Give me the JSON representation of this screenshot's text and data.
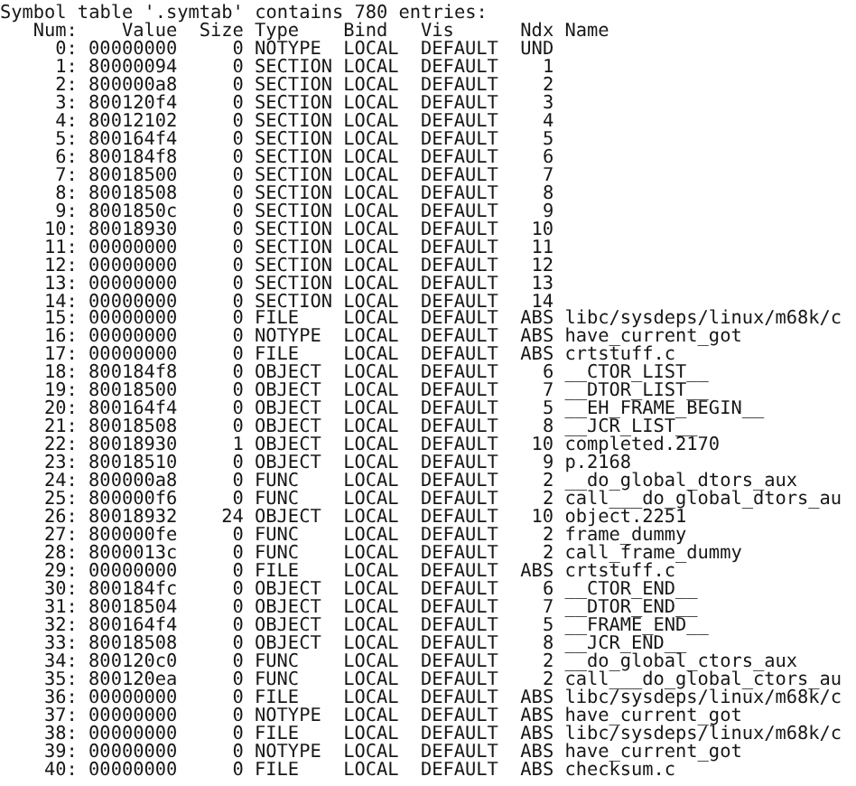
{
  "title": "Symbol table '.symtab' contains 780 entries:",
  "columns": [
    "Num:",
    "Value",
    "Size",
    "Type",
    "Bind",
    "Vis",
    "Ndx",
    "Name"
  ],
  "rows": [
    {
      "num": "0:",
      "value": "00000000",
      "size": "0",
      "type": "NOTYPE",
      "bind": "LOCAL",
      "vis": "DEFAULT",
      "ndx": "UND",
      "name": ""
    },
    {
      "num": "1:",
      "value": "80000094",
      "size": "0",
      "type": "SECTION",
      "bind": "LOCAL",
      "vis": "DEFAULT",
      "ndx": "1",
      "name": ""
    },
    {
      "num": "2:",
      "value": "800000a8",
      "size": "0",
      "type": "SECTION",
      "bind": "LOCAL",
      "vis": "DEFAULT",
      "ndx": "2",
      "name": ""
    },
    {
      "num": "3:",
      "value": "800120f4",
      "size": "0",
      "type": "SECTION",
      "bind": "LOCAL",
      "vis": "DEFAULT",
      "ndx": "3",
      "name": ""
    },
    {
      "num": "4:",
      "value": "80012102",
      "size": "0",
      "type": "SECTION",
      "bind": "LOCAL",
      "vis": "DEFAULT",
      "ndx": "4",
      "name": ""
    },
    {
      "num": "5:",
      "value": "800164f4",
      "size": "0",
      "type": "SECTION",
      "bind": "LOCAL",
      "vis": "DEFAULT",
      "ndx": "5",
      "name": ""
    },
    {
      "num": "6:",
      "value": "800184f8",
      "size": "0",
      "type": "SECTION",
      "bind": "LOCAL",
      "vis": "DEFAULT",
      "ndx": "6",
      "name": ""
    },
    {
      "num": "7:",
      "value": "80018500",
      "size": "0",
      "type": "SECTION",
      "bind": "LOCAL",
      "vis": "DEFAULT",
      "ndx": "7",
      "name": ""
    },
    {
      "num": "8:",
      "value": "80018508",
      "size": "0",
      "type": "SECTION",
      "bind": "LOCAL",
      "vis": "DEFAULT",
      "ndx": "8",
      "name": ""
    },
    {
      "num": "9:",
      "value": "8001850c",
      "size": "0",
      "type": "SECTION",
      "bind": "LOCAL",
      "vis": "DEFAULT",
      "ndx": "9",
      "name": ""
    },
    {
      "num": "10:",
      "value": "80018930",
      "size": "0",
      "type": "SECTION",
      "bind": "LOCAL",
      "vis": "DEFAULT",
      "ndx": "10",
      "name": ""
    },
    {
      "num": "11:",
      "value": "00000000",
      "size": "0",
      "type": "SECTION",
      "bind": "LOCAL",
      "vis": "DEFAULT",
      "ndx": "11",
      "name": ""
    },
    {
      "num": "12:",
      "value": "00000000",
      "size": "0",
      "type": "SECTION",
      "bind": "LOCAL",
      "vis": "DEFAULT",
      "ndx": "12",
      "name": ""
    },
    {
      "num": "13:",
      "value": "00000000",
      "size": "0",
      "type": "SECTION",
      "bind": "LOCAL",
      "vis": "DEFAULT",
      "ndx": "13",
      "name": ""
    },
    {
      "num": "14:",
      "value": "00000000",
      "size": "0",
      "type": "SECTION",
      "bind": "LOCAL",
      "vis": "DEFAULT",
      "ndx": "14",
      "name": ""
    },
    {
      "num": "15:",
      "value": "00000000",
      "size": "0",
      "type": "FILE",
      "bind": "LOCAL",
      "vis": "DEFAULT",
      "ndx": "ABS",
      "name": "libc/sysdeps/linux/m68k/c"
    },
    {
      "num": "16:",
      "value": "00000000",
      "size": "0",
      "type": "NOTYPE",
      "bind": "LOCAL",
      "vis": "DEFAULT",
      "ndx": "ABS",
      "name": "have_current_got"
    },
    {
      "num": "17:",
      "value": "00000000",
      "size": "0",
      "type": "FILE",
      "bind": "LOCAL",
      "vis": "DEFAULT",
      "ndx": "ABS",
      "name": "crtstuff.c"
    },
    {
      "num": "18:",
      "value": "800184f8",
      "size": "0",
      "type": "OBJECT",
      "bind": "LOCAL",
      "vis": "DEFAULT",
      "ndx": "6",
      "name": "__CTOR_LIST__"
    },
    {
      "num": "19:",
      "value": "80018500",
      "size": "0",
      "type": "OBJECT",
      "bind": "LOCAL",
      "vis": "DEFAULT",
      "ndx": "7",
      "name": "__DTOR_LIST__"
    },
    {
      "num": "20:",
      "value": "800164f4",
      "size": "0",
      "type": "OBJECT",
      "bind": "LOCAL",
      "vis": "DEFAULT",
      "ndx": "5",
      "name": "__EH_FRAME_BEGIN__"
    },
    {
      "num": "21:",
      "value": "80018508",
      "size": "0",
      "type": "OBJECT",
      "bind": "LOCAL",
      "vis": "DEFAULT",
      "ndx": "8",
      "name": "__JCR_LIST__"
    },
    {
      "num": "22:",
      "value": "80018930",
      "size": "1",
      "type": "OBJECT",
      "bind": "LOCAL",
      "vis": "DEFAULT",
      "ndx": "10",
      "name": "completed.2170"
    },
    {
      "num": "23:",
      "value": "80018510",
      "size": "0",
      "type": "OBJECT",
      "bind": "LOCAL",
      "vis": "DEFAULT",
      "ndx": "9",
      "name": "p.2168"
    },
    {
      "num": "24:",
      "value": "800000a8",
      "size": "0",
      "type": "FUNC",
      "bind": "LOCAL",
      "vis": "DEFAULT",
      "ndx": "2",
      "name": "__do_global_dtors_aux"
    },
    {
      "num": "25:",
      "value": "800000f6",
      "size": "0",
      "type": "FUNC",
      "bind": "LOCAL",
      "vis": "DEFAULT",
      "ndx": "2",
      "name": "call___do_global_dtors_au"
    },
    {
      "num": "26:",
      "value": "80018932",
      "size": "24",
      "type": "OBJECT",
      "bind": "LOCAL",
      "vis": "DEFAULT",
      "ndx": "10",
      "name": "object.2251"
    },
    {
      "num": "27:",
      "value": "800000fe",
      "size": "0",
      "type": "FUNC",
      "bind": "LOCAL",
      "vis": "DEFAULT",
      "ndx": "2",
      "name": "frame_dummy"
    },
    {
      "num": "28:",
      "value": "8000013c",
      "size": "0",
      "type": "FUNC",
      "bind": "LOCAL",
      "vis": "DEFAULT",
      "ndx": "2",
      "name": "call_frame_dummy"
    },
    {
      "num": "29:",
      "value": "00000000",
      "size": "0",
      "type": "FILE",
      "bind": "LOCAL",
      "vis": "DEFAULT",
      "ndx": "ABS",
      "name": "crtstuff.c"
    },
    {
      "num": "30:",
      "value": "800184fc",
      "size": "0",
      "type": "OBJECT",
      "bind": "LOCAL",
      "vis": "DEFAULT",
      "ndx": "6",
      "name": "__CTOR_END__"
    },
    {
      "num": "31:",
      "value": "80018504",
      "size": "0",
      "type": "OBJECT",
      "bind": "LOCAL",
      "vis": "DEFAULT",
      "ndx": "7",
      "name": "__DTOR_END__"
    },
    {
      "num": "32:",
      "value": "800164f4",
      "size": "0",
      "type": "OBJECT",
      "bind": "LOCAL",
      "vis": "DEFAULT",
      "ndx": "5",
      "name": "__FRAME_END__"
    },
    {
      "num": "33:",
      "value": "80018508",
      "size": "0",
      "type": "OBJECT",
      "bind": "LOCAL",
      "vis": "DEFAULT",
      "ndx": "8",
      "name": "__JCR_END__"
    },
    {
      "num": "34:",
      "value": "800120c0",
      "size": "0",
      "type": "FUNC",
      "bind": "LOCAL",
      "vis": "DEFAULT",
      "ndx": "2",
      "name": "__do_global_ctors_aux"
    },
    {
      "num": "35:",
      "value": "800120ea",
      "size": "0",
      "type": "FUNC",
      "bind": "LOCAL",
      "vis": "DEFAULT",
      "ndx": "2",
      "name": "call___do_global_ctors_au"
    },
    {
      "num": "36:",
      "value": "00000000",
      "size": "0",
      "type": "FILE",
      "bind": "LOCAL",
      "vis": "DEFAULT",
      "ndx": "ABS",
      "name": "libc/sysdeps/linux/m68k/c"
    },
    {
      "num": "37:",
      "value": "00000000",
      "size": "0",
      "type": "NOTYPE",
      "bind": "LOCAL",
      "vis": "DEFAULT",
      "ndx": "ABS",
      "name": "have_current_got"
    },
    {
      "num": "38:",
      "value": "00000000",
      "size": "0",
      "type": "FILE",
      "bind": "LOCAL",
      "vis": "DEFAULT",
      "ndx": "ABS",
      "name": "libc/sysdeps/linux/m68k/c"
    },
    {
      "num": "39:",
      "value": "00000000",
      "size": "0",
      "type": "NOTYPE",
      "bind": "LOCAL",
      "vis": "DEFAULT",
      "ndx": "ABS",
      "name": "have_current_got"
    },
    {
      "num": "40:",
      "value": "00000000",
      "size": "0",
      "type": "FILE",
      "bind": "LOCAL",
      "vis": "DEFAULT",
      "ndx": "ABS",
      "name": "checksum.c"
    }
  ]
}
